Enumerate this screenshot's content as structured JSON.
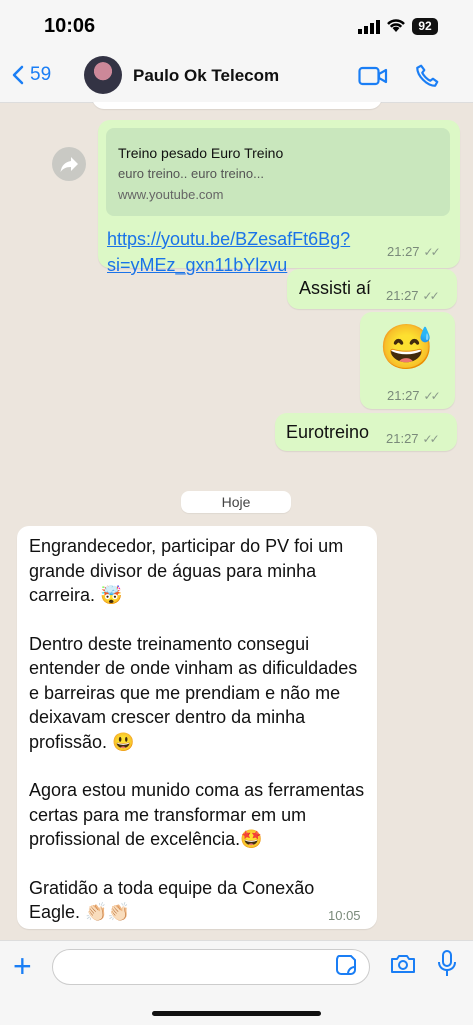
{
  "status": {
    "time": "10:06",
    "battery": "92"
  },
  "header": {
    "back_count": "59",
    "contact_name": "Paulo Ok Telecom"
  },
  "messages": {
    "link_preview": {
      "title": "Treino pesado   Euro Treino",
      "description": "euro  treino.. euro  treino...",
      "domain": "www.youtube.com",
      "url_line1": "https://youtu.be/BZesafFt6Bg?",
      "url_line2": "si=yMEz_gxn11bYlzvu",
      "time": "21:27"
    },
    "msg_assisti": {
      "text": "Assisti aí",
      "time": "21:27"
    },
    "msg_emoji": {
      "text": "😅",
      "time": "21:27"
    },
    "msg_eurotreino": {
      "text": "Eurotreino",
      "time": "21:27"
    },
    "date_separator": "Hoje",
    "incoming": {
      "p1": "Engrandecedor, participar do PV foi um grande divisor de águas para minha carreira. 🤯",
      "p2": "Dentro deste treinamento consegui entender de onde vinham as dificuldades e barreiras que me prendiam e não me deixavam crescer dentro da minha profissão. 😃",
      "p3": "Agora estou munido coma as ferramentas certas para me transformar em um profissional de excelência.🤩",
      "p4": "Gratidão a toda equipe da Conexão Eagle. 👏🏻👏🏻",
      "time": "10:05"
    }
  },
  "icons": {
    "back": "chevron-left-icon",
    "video": "video-camera-icon",
    "phone": "phone-icon",
    "plus": "plus-icon",
    "sticker": "sticker-icon",
    "camera": "camera-icon",
    "mic": "microphone-icon"
  },
  "colors": {
    "accent": "#1A7EF5",
    "outgoing_bubble": "#DCF8C6",
    "incoming_bubble": "#FFFFFF",
    "chat_bg": "#ECE5DD"
  }
}
